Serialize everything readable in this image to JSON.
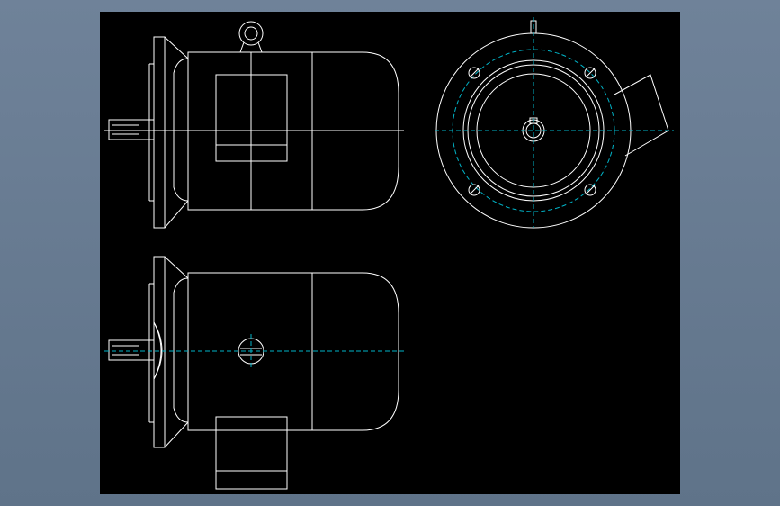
{
  "colors": {
    "background": "#6a7d93",
    "viewport": "#000000",
    "linework": "#ffffff",
    "centerline": "#00b4c8"
  },
  "views": [
    "front-elevation",
    "end-view",
    "top-view"
  ]
}
